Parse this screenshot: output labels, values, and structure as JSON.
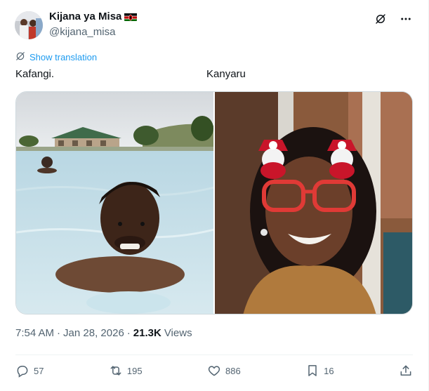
{
  "author": {
    "name": "Kijana ya Misa",
    "handle": "@kijana_misa",
    "flag": "kenya-flag"
  },
  "icons": {
    "grok": "grok-icon",
    "more": "more-horizontal-icon",
    "translate": "translate-globe-icon"
  },
  "translate_label": "Show translation",
  "captions": {
    "left": "Kafangi.",
    "right": "Kanyaru"
  },
  "media": {
    "left_photo": "man-swimming-in-pool-photo",
    "right_photo": "woman-with-christmas-glasses-photo"
  },
  "meta": {
    "time": "7:54 AM",
    "separator1": "·",
    "date": "Jan 28, 2026",
    "separator2": "·",
    "views_count": "21.3K",
    "views_label": "Views"
  },
  "actions": {
    "replies": "57",
    "reposts": "195",
    "likes": "886",
    "bookmarks": "16"
  },
  "colors": {
    "accent": "#1d9bf0",
    "text": "#0f1419",
    "muted": "#536471"
  }
}
